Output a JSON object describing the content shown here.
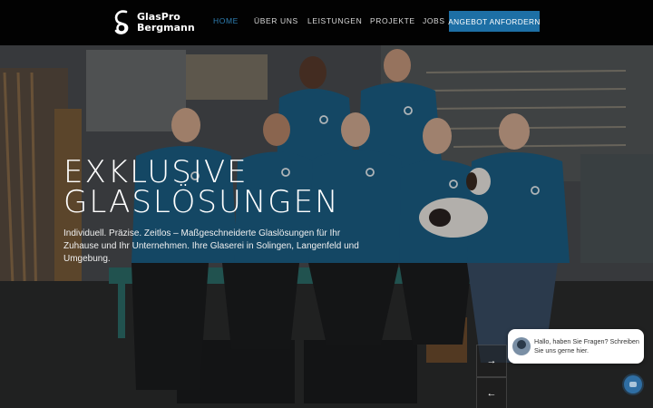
{
  "brand": {
    "line1": "GlasPro",
    "line2": "Bergmann"
  },
  "nav": {
    "items": [
      {
        "label": "HOME",
        "active": true
      },
      {
        "label": "ÜBER UNS",
        "active": false
      },
      {
        "label": "LEISTUNGEN",
        "active": false
      },
      {
        "label": "PROJEKTE",
        "active": false
      },
      {
        "label": "JOBS",
        "active": false
      }
    ],
    "cta_label": "ANGEBOT ANFORDERN"
  },
  "hero": {
    "title_line1": "EXKLUSIVE",
    "title_line2": "GLASLÖSUNGEN",
    "subtitle": "Individuell. Präzise. Zeitlos – Maßgeschneiderte Glaslösungen für Ihr Zuhause und Ihr Unternehmen. Ihre Glaserei in Solingen, Langenfeld und Umgebung."
  },
  "slider": {
    "next_icon": "→",
    "prev_icon": "←"
  },
  "chat": {
    "message": "Hallo, haben Sie Fragen? Schreiben Sie uns gerne hier."
  },
  "colors": {
    "accent": "#1d6fa5",
    "active_nav": "#2f7fb3",
    "header_bg": "#020202",
    "hoodie": "#1b5f86"
  }
}
